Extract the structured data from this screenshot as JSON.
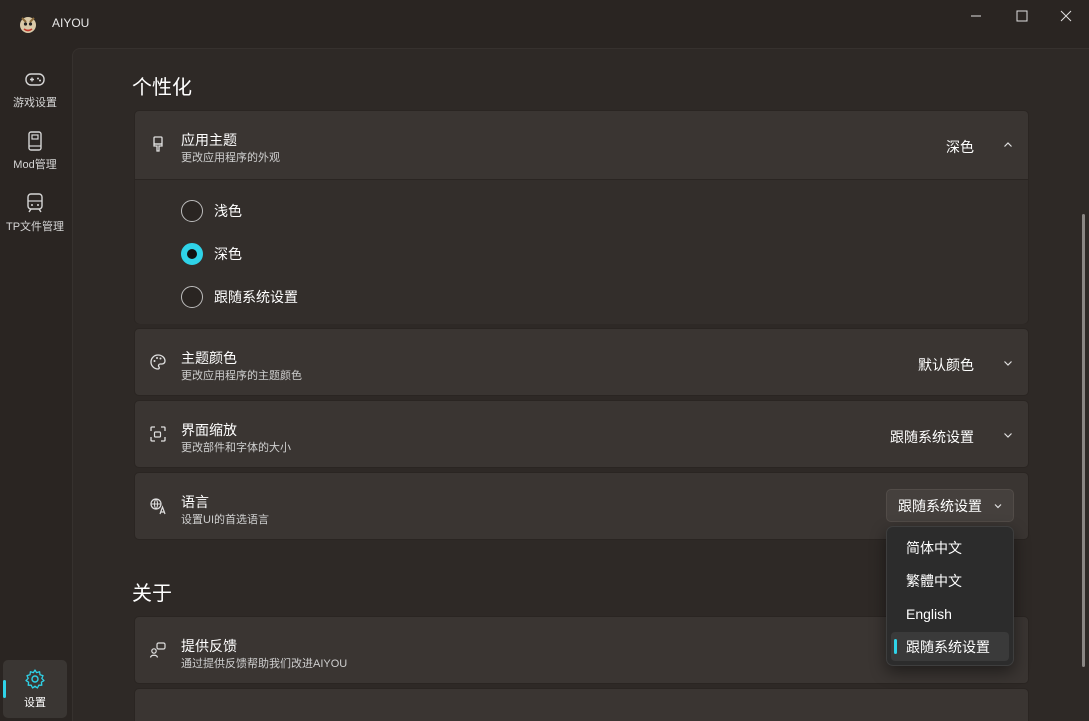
{
  "app": {
    "title": "AIYOU"
  },
  "sidebar": {
    "items": [
      {
        "label": "游戏设置",
        "icon": "gamepad-icon"
      },
      {
        "label": "Mod管理",
        "icon": "book-icon"
      },
      {
        "label": "TP文件管理",
        "icon": "train-icon"
      },
      {
        "label": "设置",
        "icon": "gear-icon",
        "selected": true
      }
    ]
  },
  "accent_color": "#2fd3e8",
  "personalization": {
    "title": "个性化",
    "theme": {
      "title": "应用主题",
      "subtitle": "更改应用程序的外观",
      "value": "深色",
      "expanded": true,
      "options": [
        "浅色",
        "深色",
        "跟随系统设置"
      ],
      "selected": "深色"
    },
    "theme_color": {
      "title": "主题颜色",
      "subtitle": "更改应用程序的主题颜色",
      "value": "默认颜色"
    },
    "scale": {
      "title": "界面缩放",
      "subtitle": "更改部件和字体的大小",
      "value": "跟随系统设置"
    },
    "language": {
      "title": "语言",
      "subtitle": "设置UI的首选语言",
      "value": "跟随系统设置",
      "options": [
        "简体中文",
        "繁體中文",
        "English",
        "跟随系统设置"
      ],
      "selected": "跟随系统设置"
    }
  },
  "about": {
    "title": "关于",
    "feedback": {
      "title": "提供反馈",
      "subtitle": "通过提供反馈帮助我们改进AIYOU"
    }
  }
}
